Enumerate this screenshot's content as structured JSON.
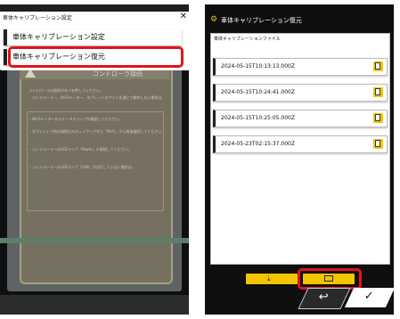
{
  "left": {
    "background": {
      "card_title": "コントローラ接続",
      "lines": [
        "コントローラの接続ボタンを押してください。",
        "・コントローラー、Wi-Fiルーター、タブレットのファンを通じて動作しない場合は...",
        "・Wi-Fiルーターのステータスランプを確認してください。",
        "・タブレットで他の接続先のネットワークから「Wi-Fi」から再度接続してください。",
        "・コントローラーのLEDランプ「Power」の接続してください。",
        "・コントローラーのLEDランプ「LAN」が点灯していない場合は..."
      ]
    },
    "menu": {
      "title": "車体キャリブレーション設定",
      "close_glyph": "✕",
      "items": [
        {
          "label": "車体キャリブレーション設定"
        },
        {
          "label": "車体キャリブレーション復元"
        }
      ]
    }
  },
  "right": {
    "header": {
      "title": "車体キャリブレーション復元",
      "icon": "gear-icon"
    },
    "section_label": "車体キャリブレーションファイル",
    "files": [
      {
        "name": "2024-05-15T10:13:13.000Z"
      },
      {
        "name": "2024-05-15T10:24:41.000Z"
      },
      {
        "name": "2024-05-15T10:25:05.000Z"
      },
      {
        "name": "2024-05-23T02:15:37.000Z"
      }
    ],
    "actions": {
      "download_glyph": "⤓",
      "folder_icon": "folder-icon"
    },
    "nav": {
      "back_glyph": "↩",
      "ok_glyph": "✓"
    }
  },
  "colors": {
    "accent": "#f3c400",
    "highlight": "#e0141c",
    "dark": "#0f0f10"
  }
}
